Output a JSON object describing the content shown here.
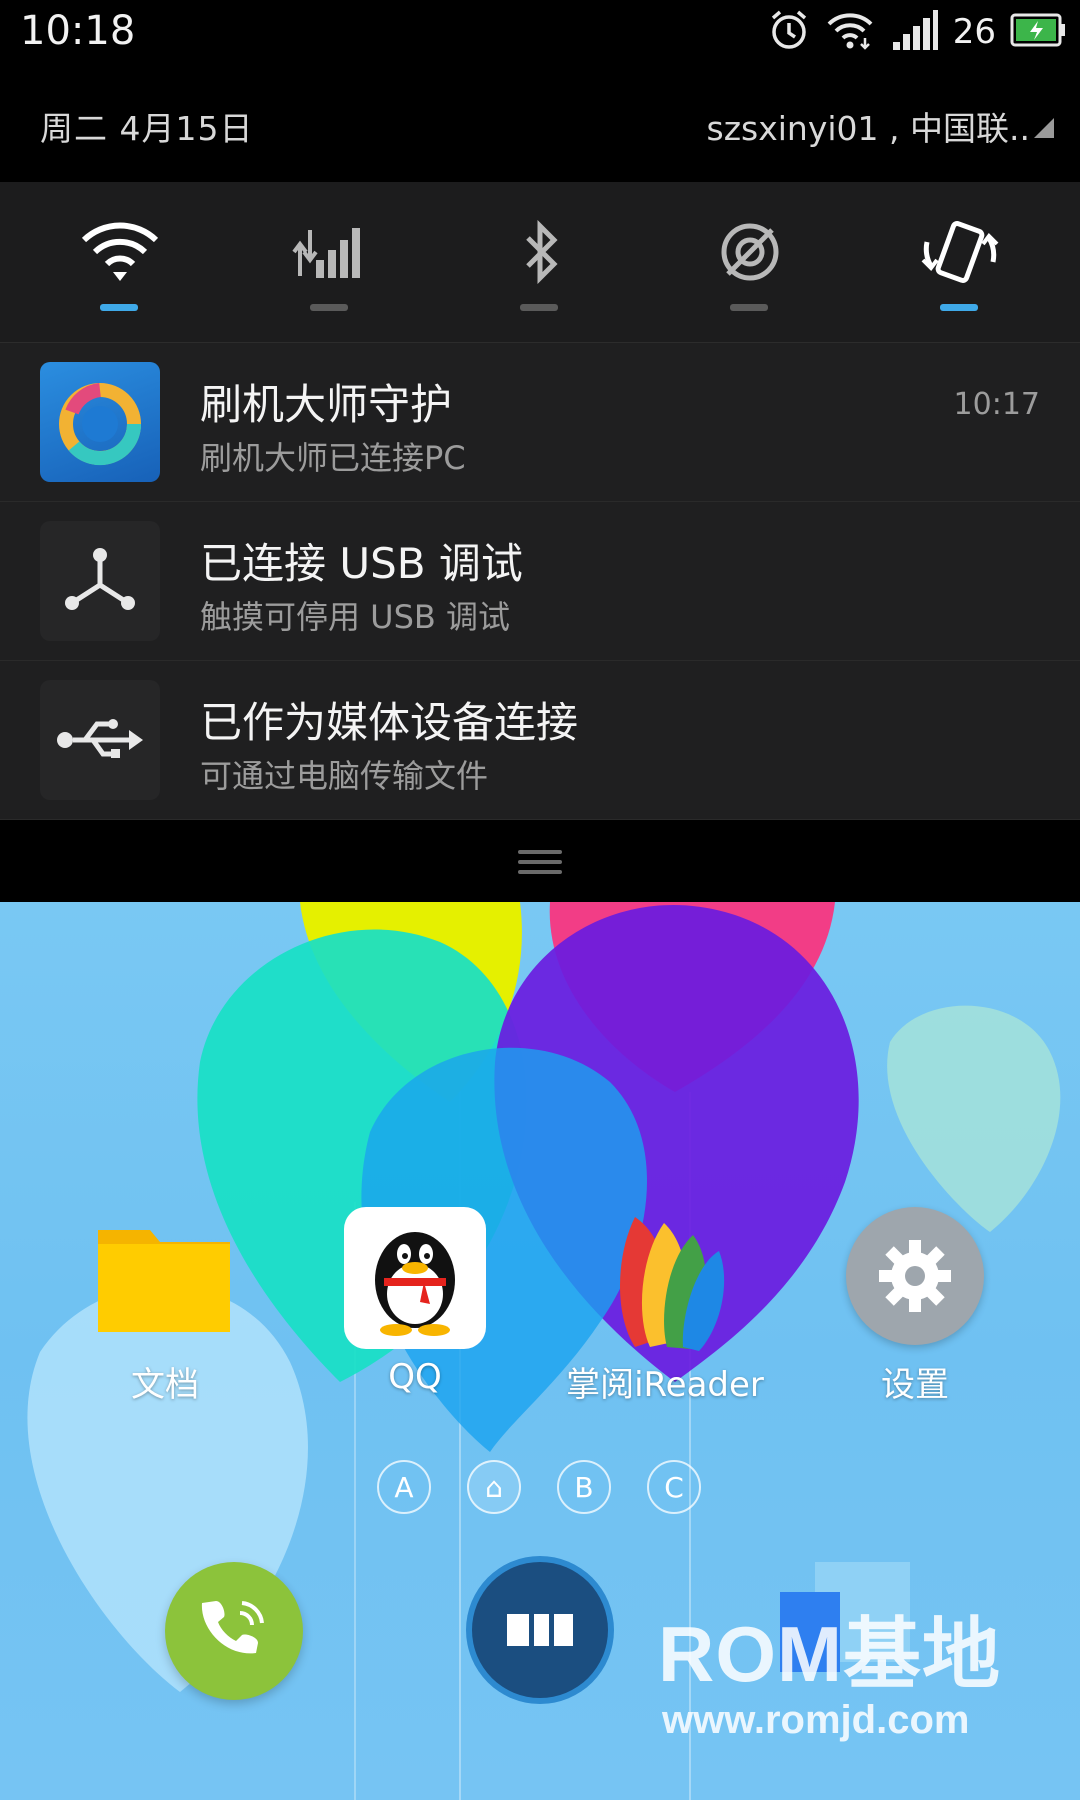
{
  "status_bar": {
    "time": "10:18",
    "battery_level": "26",
    "icons": [
      "alarm-icon",
      "wifi-icon",
      "signal-icon",
      "battery-charging-icon"
    ]
  },
  "shade_header": {
    "date": "周二  4月15日",
    "carrier": "szsxinyi01 , 中国联.."
  },
  "quick_toggles": [
    {
      "name": "wifi",
      "icon": "wifi-icon",
      "active": true
    },
    {
      "name": "mobile-data",
      "icon": "mobile-data-icon",
      "active": false
    },
    {
      "name": "bluetooth",
      "icon": "bluetooth-icon",
      "active": false
    },
    {
      "name": "gps",
      "icon": "gps-off-icon",
      "active": false
    },
    {
      "name": "auto-rotate",
      "icon": "rotate-icon",
      "active": true
    }
  ],
  "notifications": [
    {
      "title": "刷机大师守护",
      "subtitle": "刷机大师已连接PC",
      "time": "10:17",
      "icon": "shuaji-dashi-app-icon"
    },
    {
      "title": "已连接 USB 调试",
      "subtitle": "触摸可停用 USB 调试",
      "time": "",
      "icon": "usb-debug-icon"
    },
    {
      "title": "已作为媒体设备连接",
      "subtitle": "可通过电脑传输文件",
      "time": "",
      "icon": "usb-icon"
    }
  ],
  "home": {
    "apps": [
      {
        "label": "文档",
        "icon": "folder-icon"
      },
      {
        "label": "QQ",
        "icon": "qq-penguin-icon"
      },
      {
        "label": "掌阅iReader",
        "icon": "ireader-book-icon"
      },
      {
        "label": "设置",
        "icon": "gear-icon"
      }
    ],
    "pages": [
      "A",
      "⌂",
      "B",
      "C"
    ],
    "dock": [
      "phone-icon",
      "app-store-icon"
    ],
    "watermark": {
      "main": "ROM基地",
      "url": "www.romjd.com"
    }
  },
  "colors": {
    "accent": "#3fa9e8",
    "shade_bg": "#1f1f20",
    "phone_green": "#8cc33b"
  }
}
